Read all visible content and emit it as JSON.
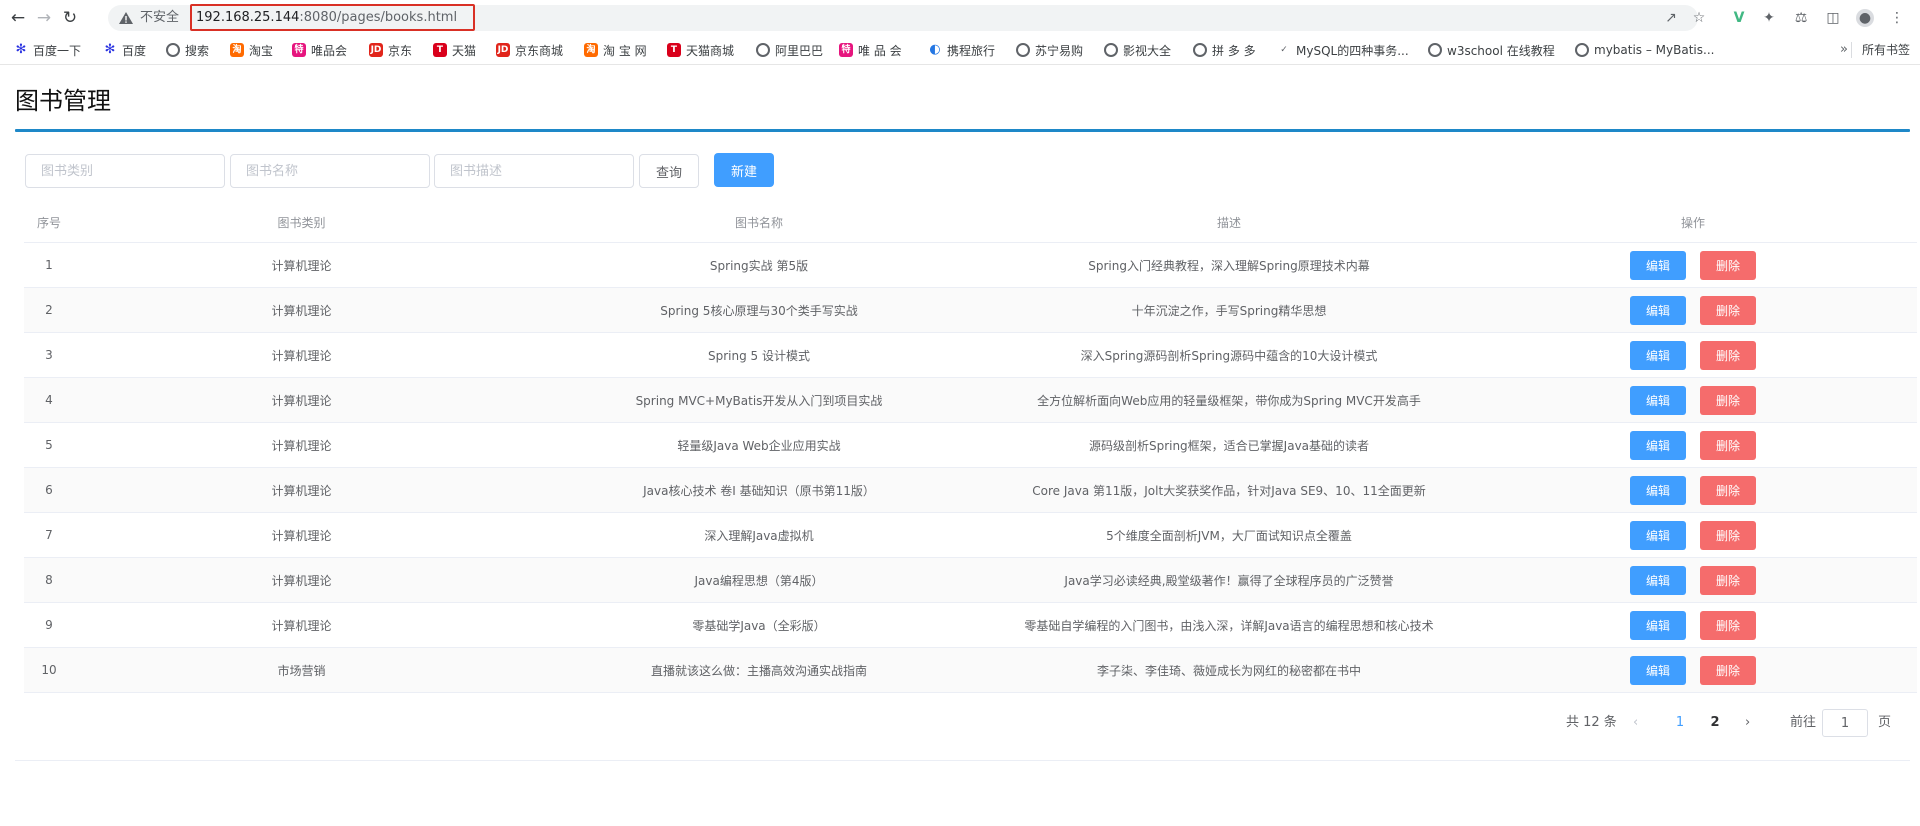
{
  "browser": {
    "security_label": "不安全",
    "url_host": "192.168.25.144",
    "url_rest": ":8080/pages/books.html",
    "bookmarks": [
      {
        "label": "百度一下",
        "icon": "baidu-paw",
        "color": "#2932e1"
      },
      {
        "label": "百度",
        "icon": "baidu-paw",
        "color": "#2932e1"
      },
      {
        "label": "搜索",
        "icon": "globe",
        "color": "#5f6368"
      },
      {
        "label": "淘宝",
        "icon": "taobao",
        "color": "#ff6a00"
      },
      {
        "label": "唯品会",
        "icon": "vip",
        "color": "#e6157e"
      },
      {
        "label": "京东",
        "icon": "jd",
        "color": "#e1251b"
      },
      {
        "label": "天猫",
        "icon": "tmall",
        "color": "#d9001b"
      },
      {
        "label": "京东商城",
        "icon": "jd",
        "color": "#e1251b"
      },
      {
        "label": "淘 宝 网",
        "icon": "taobao",
        "color": "#ff6a00"
      },
      {
        "label": "天猫商城",
        "icon": "tmall",
        "color": "#d9001b"
      },
      {
        "label": "阿里巴巴",
        "icon": "globe",
        "color": "#5f6368"
      },
      {
        "label": "唯 品 会",
        "icon": "vip",
        "color": "#e6157e"
      },
      {
        "label": "携程旅行",
        "icon": "ctrip",
        "color": "#2577e3"
      },
      {
        "label": "苏宁易购",
        "icon": "globe",
        "color": "#5f6368"
      },
      {
        "label": "影视大全",
        "icon": "globe",
        "color": "#5f6368"
      },
      {
        "label": "拼 多 多",
        "icon": "globe",
        "color": "#5f6368"
      },
      {
        "label": "MySQL的四种事务...",
        "icon": "mysql",
        "color": "#5f6368"
      },
      {
        "label": "w3school 在线教程",
        "icon": "globe",
        "color": "#5f6368"
      },
      {
        "label": "mybatis – MyBatis...",
        "icon": "globe",
        "color": "#5f6368"
      }
    ],
    "bookmarks_all": "所有书签"
  },
  "page": {
    "title": "图书管理"
  },
  "search": {
    "category_placeholder": "图书类别",
    "name_placeholder": "图书名称",
    "description_placeholder": "图书描述",
    "query_label": "查询",
    "new_label": "新建"
  },
  "table": {
    "headers": {
      "index": "序号",
      "category": "图书类别",
      "name": "图书名称",
      "description": "描述",
      "operations": "操作"
    },
    "edit_label": "编辑",
    "delete_label": "删除",
    "rows": [
      {
        "index": "1",
        "category": "计算机理论",
        "name": "Spring实战 第5版",
        "description": "Spring入门经典教程，深入理解Spring原理技术内幕"
      },
      {
        "index": "2",
        "category": "计算机理论",
        "name": "Spring 5核心原理与30个类手写实战",
        "description": "十年沉淀之作，手写Spring精华思想"
      },
      {
        "index": "3",
        "category": "计算机理论",
        "name": "Spring 5 设计模式",
        "description": "深入Spring源码剖析Spring源码中蕴含的10大设计模式"
      },
      {
        "index": "4",
        "category": "计算机理论",
        "name": "Spring MVC+MyBatis开发从入门到项目实战",
        "description": "全方位解析面向Web应用的轻量级框架，带你成为Spring MVC开发高手"
      },
      {
        "index": "5",
        "category": "计算机理论",
        "name": "轻量级Java Web企业应用实战",
        "description": "源码级剖析Spring框架，适合已掌握Java基础的读者"
      },
      {
        "index": "6",
        "category": "计算机理论",
        "name": "Java核心技术 卷I 基础知识（原书第11版）",
        "description": "Core Java 第11版，Jolt大奖获奖作品，针对Java SE9、10、11全面更新"
      },
      {
        "index": "7",
        "category": "计算机理论",
        "name": "深入理解Java虚拟机",
        "description": "5个维度全面剖析JVM，大厂面试知识点全覆盖"
      },
      {
        "index": "8",
        "category": "计算机理论",
        "name": "Java编程思想（第4版）",
        "description": "Java学习必读经典,殿堂级著作！赢得了全球程序员的广泛赞誉"
      },
      {
        "index": "9",
        "category": "计算机理论",
        "name": "零基础学Java（全彩版）",
        "description": "零基础自学编程的入门图书，由浅入深，详解Java语言的编程思想和核心技术"
      },
      {
        "index": "10",
        "category": "市场营销",
        "name": "直播就该这么做：主播高效沟通实战指南",
        "description": "李子柒、李佳琦、薇娅成长为网红的秘密都在书中"
      }
    ]
  },
  "pagination": {
    "total_text": "共 12 条",
    "pages": [
      "1",
      "2"
    ],
    "current_page": "1",
    "goto_label": "前往",
    "goto_value": "1",
    "goto_unit": "页"
  },
  "colors": {
    "primary": "#409eff",
    "danger": "#f56c6c",
    "title_rule": "#1e88c8"
  }
}
